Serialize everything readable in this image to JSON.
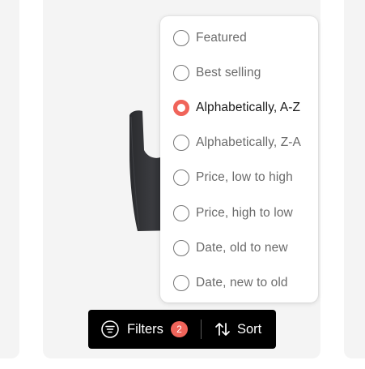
{
  "sort_menu": {
    "options": [
      {
        "label": "Featured",
        "selected": false
      },
      {
        "label": "Best selling",
        "selected": false
      },
      {
        "label": "Alphabetically, A-Z",
        "selected": true
      },
      {
        "label": "Alphabetically, Z-A",
        "selected": false
      },
      {
        "label": "Price, low to high",
        "selected": false
      },
      {
        "label": "Price, high to low",
        "selected": false
      },
      {
        "label": "Date, old to new",
        "selected": false
      },
      {
        "label": "Date, new to old",
        "selected": false
      }
    ],
    "accent_color": "#f0645a"
  },
  "toolbar": {
    "filters_label": "Filters",
    "filters_count": "2",
    "filters_icon": "filter-icon",
    "sort_label": "Sort",
    "sort_icon": "sort-arrows-icon",
    "background_color": "#000000"
  },
  "product": {
    "image_icon": "black-bodysuit-image"
  }
}
